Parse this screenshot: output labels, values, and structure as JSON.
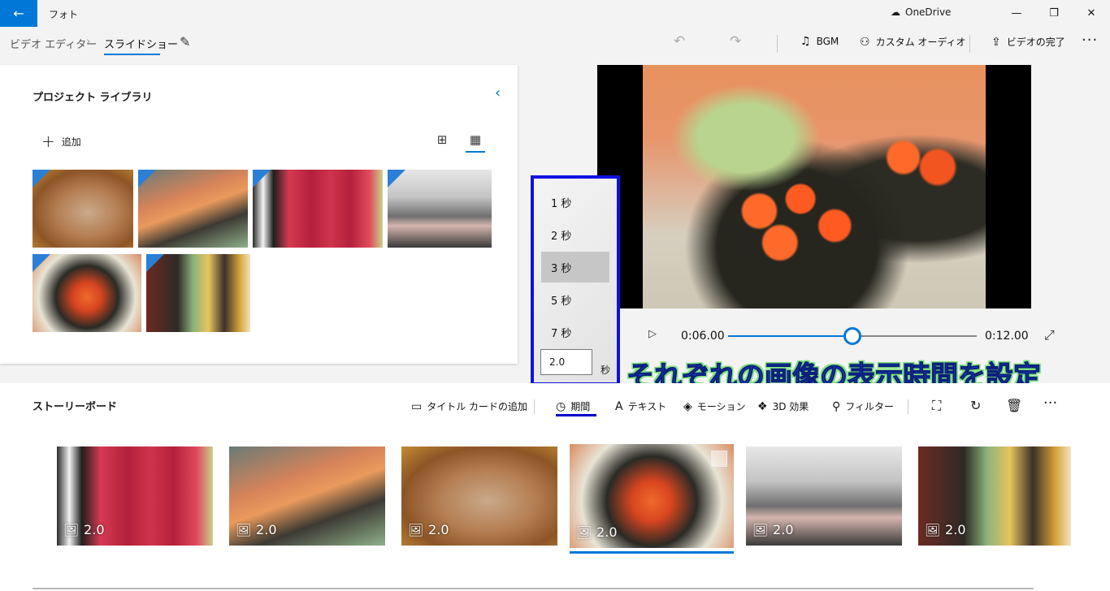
{
  "titlebar": {
    "back_icon": "←",
    "app_title": "フォト",
    "onedrive_label": "OneDrive",
    "onedrive_icon": "☁",
    "minimize_icon": "—",
    "maximize_icon": "❐",
    "close_icon": "✕"
  },
  "breadcrumb": {
    "items": [
      "ビデオ エディター",
      "スライドショー"
    ],
    "separator": "›",
    "edit_icon": "✎"
  },
  "toolbar": {
    "undo_icon": "↶",
    "redo_icon": "↷",
    "bgm_icon": "♫",
    "bgm_label": "BGM",
    "custom_audio_icon": "⚇",
    "custom_audio_label": "カスタム オーディオ",
    "finish_icon": "⇪",
    "finish_label": "ビデオの完了",
    "more_label": "···"
  },
  "library": {
    "title": "プロジェクト ライブラリ",
    "collapse_icon": "‹",
    "add_icon": "+",
    "add_label": "追加",
    "view_large_icon": "⊞",
    "view_small_icon": "▦"
  },
  "player": {
    "play_icon": "▷",
    "current_time": "0:06.00",
    "total_time": "0:12.00",
    "progress": 0.5,
    "fullscreen_icon": "⤢"
  },
  "duration_menu": {
    "options": [
      "1 秒",
      "2 秒",
      "3 秒",
      "5 秒",
      "7 秒"
    ],
    "selected_index": 2,
    "custom_value": "2.0",
    "unit": "秒"
  },
  "annotation": "それぞれの画像の表示時間を設定",
  "storyboard": {
    "title": "ストーリーボード",
    "commands": {
      "title_card_icon": "▭",
      "title_card": "タイトル カードの追加",
      "duration_icon": "◷",
      "duration": "期間",
      "text_icon": "A",
      "text": "テキスト",
      "motion_icon": "◈",
      "motion": "モーション",
      "effects_icon": "❖",
      "effects": "3D 効果",
      "filter_icon": "⚲",
      "filter": "フィルター",
      "resize_icon": "⛶",
      "rotate_icon": "↻",
      "delete_icon": "🗑",
      "more": "···"
    },
    "cards": [
      {
        "duration": "2.0"
      },
      {
        "duration": "2.0"
      },
      {
        "duration": "2.0"
      },
      {
        "duration": "2.0"
      },
      {
        "duration": "2.0"
      },
      {
        "duration": "2.0"
      }
    ],
    "card_icon": "🖼"
  },
  "colors": {
    "accent": "#0078d7",
    "annotation_box": "#1010e0",
    "annotation_text": "#1f4fd6",
    "annotation_outline": "#7fe07f"
  }
}
